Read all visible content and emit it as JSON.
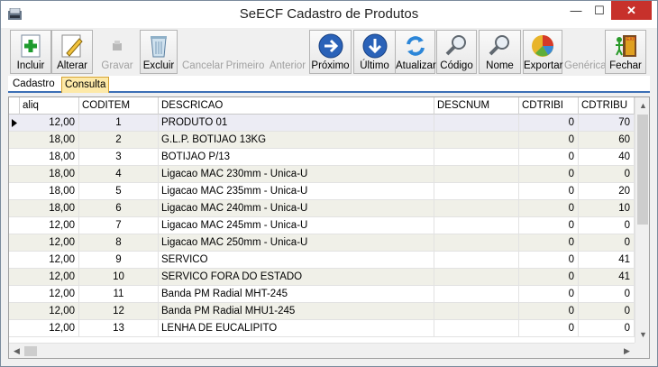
{
  "window": {
    "title": "SeECF Cadastro de Produtos",
    "min": "—",
    "max": "☐",
    "close": "✕"
  },
  "toolbar": [
    {
      "label": "Incluir",
      "icon": "add-icon",
      "enabled": true
    },
    {
      "label": "Alterar",
      "icon": "edit-icon",
      "enabled": true
    },
    {
      "label": "Gravar",
      "icon": "save-icon",
      "enabled": false
    },
    {
      "label": "Excluir",
      "icon": "trash-icon",
      "enabled": true
    },
    {
      "label": "Cancelar",
      "icon": "cancel-icon",
      "enabled": false
    },
    {
      "label": "Primeiro",
      "icon": "first-icon",
      "enabled": false
    },
    {
      "label": "Anterior",
      "icon": "previous-icon",
      "enabled": false
    },
    {
      "label": "Próximo",
      "icon": "next-icon",
      "enabled": true
    },
    {
      "label": "Último",
      "icon": "last-icon",
      "enabled": true
    },
    {
      "label": "Atualizar",
      "icon": "refresh-icon",
      "enabled": true
    },
    {
      "label": "Código",
      "icon": "search-code-icon",
      "enabled": true
    },
    {
      "label": "Nome",
      "icon": "search-name-icon",
      "enabled": true
    },
    {
      "label": "Exportar",
      "icon": "export-chart-icon",
      "enabled": true
    },
    {
      "label": "Genérica",
      "icon": "generic-icon",
      "enabled": false
    },
    {
      "label": "Fechar",
      "icon": "exit-icon",
      "enabled": true
    }
  ],
  "tabs": [
    {
      "label": "Cadastro",
      "active": false
    },
    {
      "label": "Consulta",
      "active": true
    }
  ],
  "grid": {
    "columns": [
      "aliq",
      "CODITEM",
      "DESCRICAO",
      "DESCNUM",
      "CDTRIBI",
      "CDTRIBU"
    ],
    "rows": [
      [
        "12,00",
        "1",
        "PRODUTO 01",
        "",
        "0",
        "70"
      ],
      [
        "18,00",
        "2",
        "G.L.P. BOTIJAO 13KG",
        "",
        "0",
        "60"
      ],
      [
        "18,00",
        "3",
        "BOTIJAO P/13",
        "",
        "0",
        "40"
      ],
      [
        "18,00",
        "4",
        "Ligacao MAC 230mm - Unica-U",
        "",
        "0",
        "0"
      ],
      [
        "18,00",
        "5",
        "Ligacao MAC 235mm - Unica-U",
        "",
        "0",
        "20"
      ],
      [
        "18,00",
        "6",
        "Ligacao MAC 240mm - Unica-U",
        "",
        "0",
        "10"
      ],
      [
        "12,00",
        "7",
        "Ligacao MAC 245mm - Unica-U",
        "",
        "0",
        "0"
      ],
      [
        "12,00",
        "8",
        "Ligacao MAC 250mm - Unica-U",
        "",
        "0",
        "0"
      ],
      [
        "12,00",
        "9",
        "SERVICO",
        "",
        "0",
        "41"
      ],
      [
        "12,00",
        "10",
        "SERVICO FORA DO ESTADO",
        "",
        "0",
        "41"
      ],
      [
        "12,00",
        "11",
        "Banda PM Radial MHT-245",
        "",
        "0",
        "0"
      ],
      [
        "12,00",
        "12",
        "Banda PM Radial MHU1-245",
        "",
        "0",
        "0"
      ],
      [
        "12,00",
        "13",
        "LENHA DE EUCALIPITO",
        "",
        "0",
        "0"
      ]
    ]
  }
}
